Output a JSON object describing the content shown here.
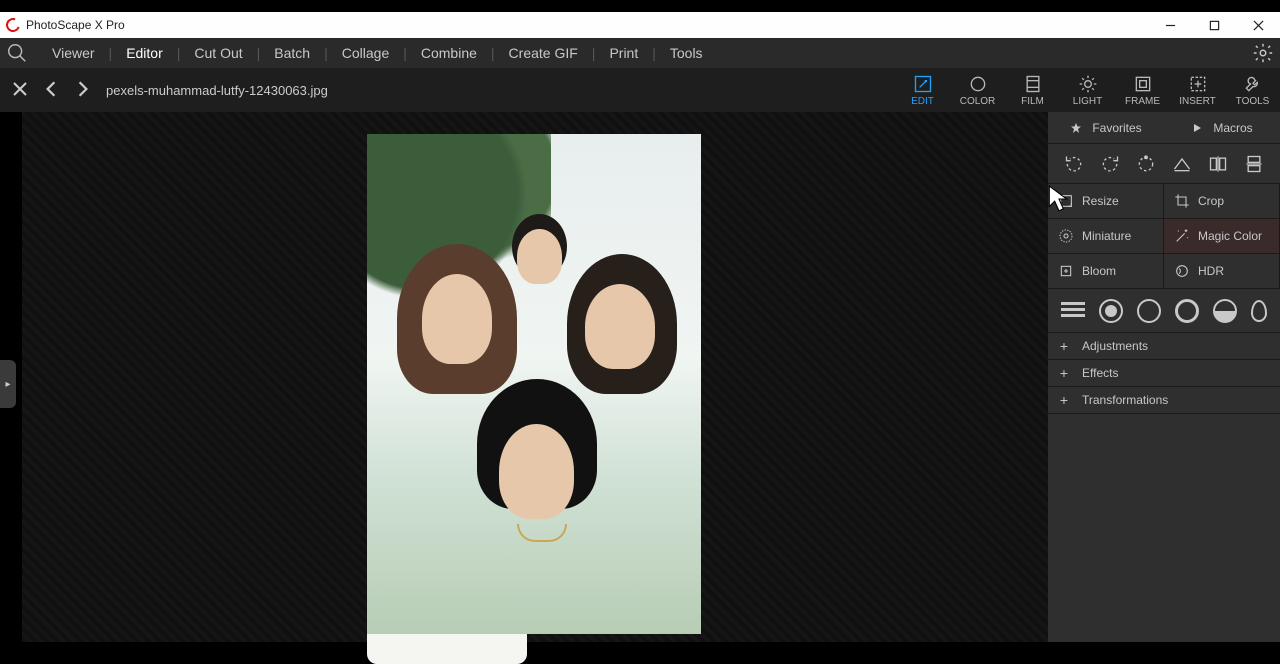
{
  "app": {
    "title": "PhotoScape X Pro"
  },
  "menu": {
    "items": [
      "Viewer",
      "Editor",
      "Cut Out",
      "Batch",
      "Collage",
      "Combine",
      "Create GIF",
      "Print",
      "Tools"
    ],
    "active_index": 1
  },
  "file": {
    "name": "pexels-muhammad-lutfy-12430063.jpg"
  },
  "tooltabs": {
    "items": [
      "EDIT",
      "COLOR",
      "FILM",
      "LIGHT",
      "FRAME",
      "INSERT",
      "TOOLS"
    ],
    "active_index": 0
  },
  "panel": {
    "favorites_label": "Favorites",
    "macros_label": "Macros",
    "actions": {
      "resize": "Resize",
      "crop": "Crop",
      "miniature": "Miniature",
      "magic_color": "Magic Color",
      "bloom": "Bloom",
      "hdr": "HDR"
    },
    "expanders": [
      "Adjustments",
      "Effects",
      "Transformations"
    ]
  },
  "icons": {
    "rotate_ccw": "rotate-ccw-icon",
    "rotate_cw": "rotate-cw-icon",
    "rotate_arbitrary": "rotate-arbitrary-icon",
    "straighten": "straighten-icon",
    "flip_h": "flip-horizontal-icon",
    "flip_v": "flip-vertical-icon"
  },
  "colors": {
    "accent": "#1ea1ff"
  }
}
